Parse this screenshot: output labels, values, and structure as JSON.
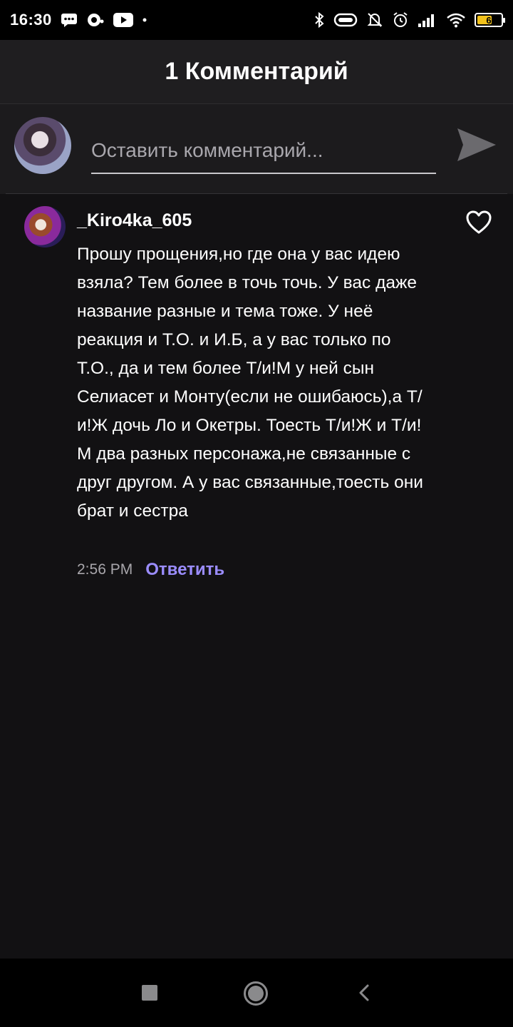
{
  "status_bar": {
    "time": "16:30",
    "left_icons": [
      "message-icon",
      "chat-bubble-icon",
      "youtube-icon",
      "dot-icon"
    ],
    "right_icons": [
      "bluetooth-icon",
      "vibrate-icon",
      "mute-icon",
      "alarm-icon",
      "signal-icon",
      "wifi-icon",
      "battery-icon"
    ],
    "battery_level": "6",
    "battery_color": "#f2c21c"
  },
  "header": {
    "title": "1 Комментарий"
  },
  "compose": {
    "placeholder": "Оставить комментарий...",
    "value": "",
    "send_icon": "send-icon"
  },
  "comments": [
    {
      "username": "_Kiro4ka_605",
      "text": "Прошу прощения,но где она у вас идею взяла? Тем более в точь точь. У вас даже название разные и тема тоже. У неё реакция и Т.О. и И.Б, а у вас только по Т.О., да и тем более Т/и!М у ней сын Селиасет и Монту(если не ошибаюсь),а Т/и!Ж дочь Ло и Окетры. Тоесть Т/и!Ж и Т/и!М два разных персонажа,не связанные с друг другом. А у вас связанные,тоесть они брат и сестра",
      "time": "2:56 PM",
      "reply_label": "Ответить",
      "like_icon": "heart-outline-icon"
    }
  ],
  "nav_bar": {
    "icons": [
      "recents-square-icon",
      "home-circle-icon",
      "back-chevron-icon"
    ]
  },
  "colors": {
    "accent": "#9b8dff",
    "background": "#121113",
    "header_bg": "#1f1e20"
  }
}
